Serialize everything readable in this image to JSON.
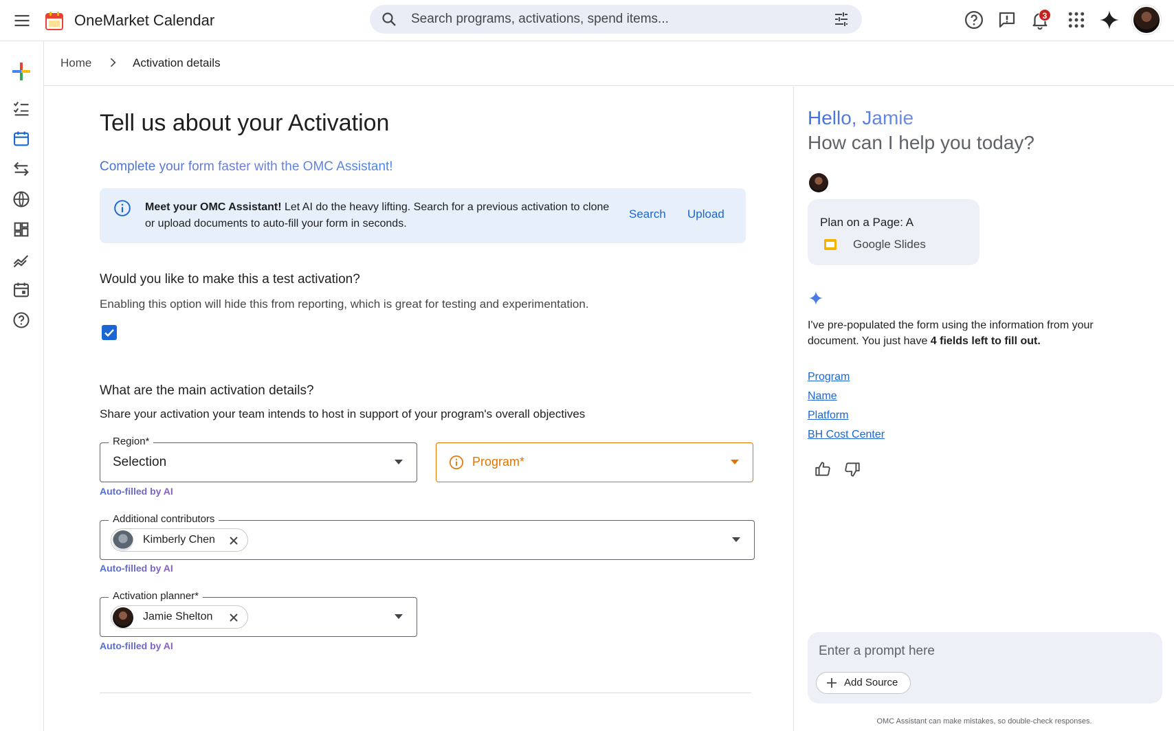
{
  "app": {
    "title": "OneMarket Calendar",
    "search_placeholder": "Search programs, activations, spend items...",
    "notification_count": "3"
  },
  "breadcrumb": {
    "home": "Home",
    "current": "Activation details"
  },
  "form": {
    "title": "Tell us about your Activation",
    "assistant_link": "Complete your form faster with the OMC Assistant!",
    "banner": {
      "bold": "Meet your OMC Assistant!",
      "text": " Let AI do the heavy lifting. Search for a previous activation to clone or upload documents to auto-fill your form in seconds.",
      "search_label": "Search",
      "upload_label": "Upload"
    },
    "test_section": {
      "title": "Would you like to make this a test activation?",
      "description": "Enabling this option will hide this from reporting, which is great for testing and experimentation.",
      "checked": true
    },
    "details_section": {
      "title": "What are the main activation details?",
      "description": "Share your activation your team intends to host in support of your program's overall objectives"
    },
    "region": {
      "label": "Region*",
      "value": "Selection",
      "note": "Auto-filled by AI"
    },
    "program": {
      "label": "Program*"
    },
    "contributors": {
      "label": "Additional contributors",
      "chip": "Kimberly Chen",
      "note": "Auto-filled by AI"
    },
    "planner": {
      "label": "Activation planner*",
      "chip": "Jamie Shelton",
      "note": "Auto-filled by AI"
    }
  },
  "assistant": {
    "greeting": "Hello, Jamie",
    "subheading": "How can I help you today?",
    "document": {
      "name": "Plan on a Page: A",
      "type": "Google Slides"
    },
    "message_prefix": "I've pre-populated the form using the information from your document. You just have ",
    "message_bold": "4 fields left to fill out.",
    "fields": [
      "Program",
      "Name",
      "Platform",
      "BH Cost Center"
    ],
    "prompt_placeholder": "Enter a prompt here",
    "add_source_label": "Add Source",
    "disclaimer": "OMC Assistant can make mistakes, so double-check responses."
  },
  "colors": {
    "accent": "#1a66d2",
    "warning": "#e37400",
    "banner_bg": "#e7effb",
    "badge": "#c5221f"
  }
}
